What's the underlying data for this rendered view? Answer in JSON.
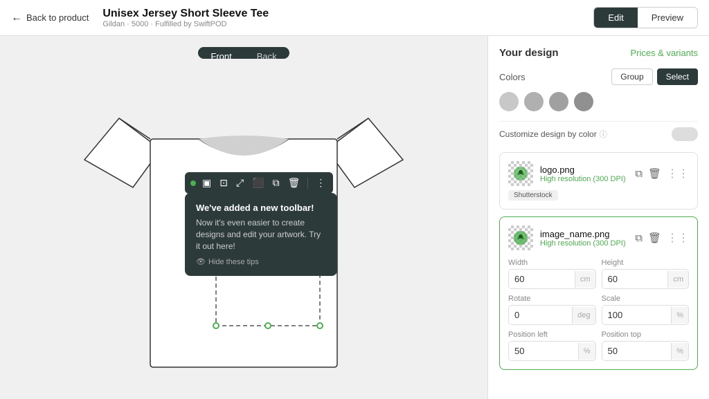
{
  "nav": {
    "back_label": "Back to product",
    "product_title": "Unisex Jersey Short Sleeve Tee",
    "product_meta": "Gildan · 5000 · Fulfilled by SwiftPOD",
    "edit_label": "Edit",
    "preview_label": "Preview"
  },
  "view_toggle": {
    "front_label": "Front",
    "back_label": "Back"
  },
  "toolbar": {
    "icons": [
      "⬜",
      "⊡",
      "⤢",
      "⬛",
      "⧉",
      "🗑",
      "⋮"
    ]
  },
  "tooltip": {
    "title": "We've added a new toolbar!",
    "text": "Now it's even easier to create designs and edit your artwork. Try it out here!",
    "hide_label": "Hide these tips"
  },
  "right_panel": {
    "title": "Your design",
    "prices_label": "Prices & variants",
    "colors_section": {
      "label": "Colors",
      "group_btn": "Group",
      "select_btn": "Select",
      "swatches": [
        "#c8c8c8",
        "#b0b0b0",
        "#a0a0a0",
        "#909090"
      ]
    },
    "customize_label": "Customize design by color",
    "design_items": [
      {
        "name": "logo.png",
        "resolution": "High resolution (300 DPI)",
        "tag": "Shutterstock"
      },
      {
        "name": "image_name.png",
        "resolution": "High resolution (300 DPI)",
        "tag": null
      }
    ],
    "fields": {
      "width_label": "Width",
      "width_value": "60",
      "width_unit": "cm",
      "height_label": "Height",
      "height_value": "60",
      "height_unit": "cm",
      "rotate_label": "Rotate",
      "rotate_value": "0",
      "rotate_unit": "deg",
      "scale_label": "Scale",
      "scale_value": "100",
      "scale_unit": "%",
      "pos_left_label": "Position left",
      "pos_left_value": "50",
      "pos_left_unit": "%",
      "pos_top_label": "Position top",
      "pos_top_value": "50",
      "pos_top_unit": "%"
    }
  }
}
